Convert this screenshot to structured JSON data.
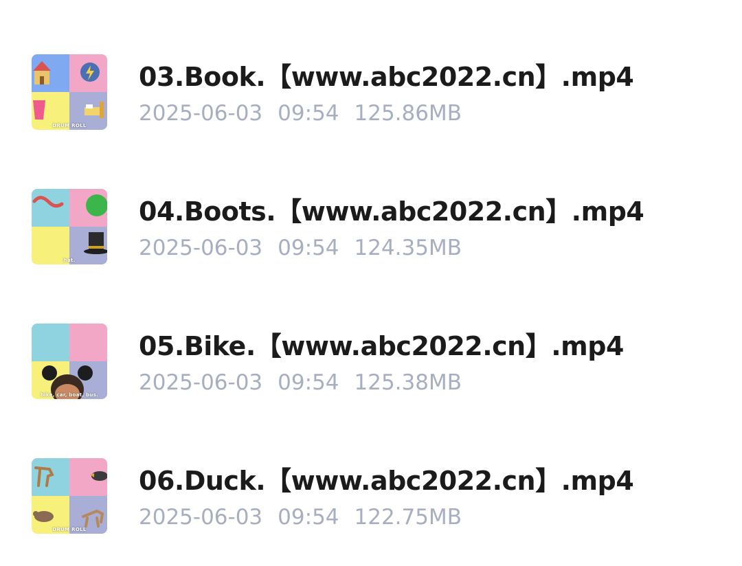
{
  "files": [
    {
      "name": "03.Book.【www.abc2022.cn】.mp4",
      "date": "2025-06-03",
      "time": "09:54",
      "size": "125.86MB",
      "thumb_caption": "DRUM ROLL",
      "thumb_icons": [
        "house-icon",
        "lightning-icon",
        "cup-icon",
        "bed-icon"
      ]
    },
    {
      "name": "04.Boots.【www.abc2022.cn】.mp4",
      "date": "2025-06-03",
      "time": "09:54",
      "size": "124.35MB",
      "thumb_caption": "hat.",
      "thumb_icons": [
        "worm-icon",
        "ball-icon",
        "hat-icon"
      ]
    },
    {
      "name": "05.Bike.【www.abc2022.cn】.mp4",
      "date": "2025-06-03",
      "time": "09:54",
      "size": "125.38MB",
      "thumb_caption": "bike, car, boat, bus.",
      "thumb_icons": [
        "girl-icon"
      ]
    },
    {
      "name": "06.Duck.【www.abc2022.cn】.mp4",
      "date": "2025-06-03",
      "time": "09:54",
      "size": "122.75MB",
      "thumb_caption": "DRUM ROLL",
      "thumb_icons": [
        "deer-icon",
        "duck-icon",
        "rat-icon",
        "dog-icon"
      ]
    }
  ],
  "colors": {
    "name_text": "#1b1b1b",
    "meta_text": "#a7aec0",
    "quad_blue": "#8fd3e0",
    "quad_pink": "#f2a7c6",
    "quad_yellow": "#f7f07a",
    "quad_purple": "#a9aed6"
  }
}
